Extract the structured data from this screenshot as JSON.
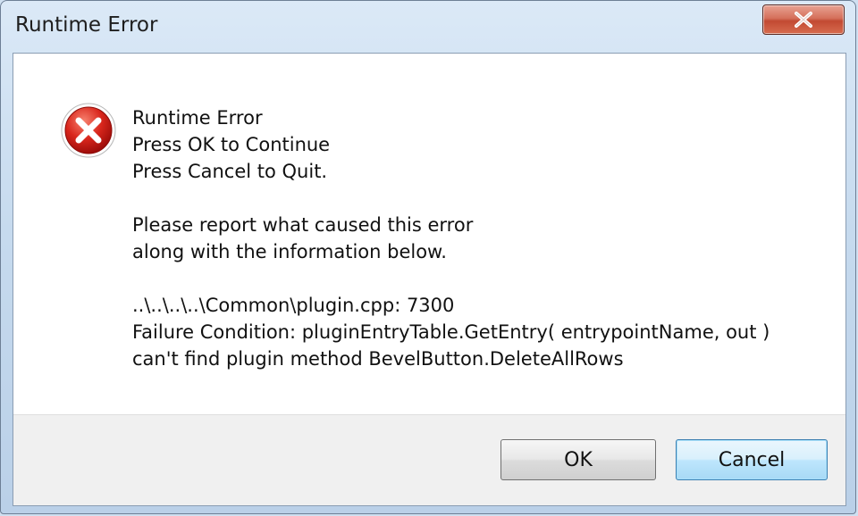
{
  "window": {
    "title": "Runtime Error",
    "close_icon": "close-icon"
  },
  "dialog": {
    "icon": "error-icon",
    "message_lines": [
      "Runtime Error",
      "Press OK to Continue",
      "Press Cancel to Quit.",
      "",
      "Please report what caused this error",
      "along with the information below.",
      "",
      "..\\..\\..\\..\\Common\\plugin.cpp: 7300",
      "Failure Condition: pluginEntryTable.GetEntry( entrypointName, out )",
      "can't find plugin method BevelButton.DeleteAllRows"
    ]
  },
  "buttons": {
    "ok_label": "OK",
    "cancel_label": "Cancel"
  },
  "colors": {
    "error_red": "#d9261c",
    "close_button_red": "#c24a32",
    "default_button_border": "#3c7fb1"
  }
}
